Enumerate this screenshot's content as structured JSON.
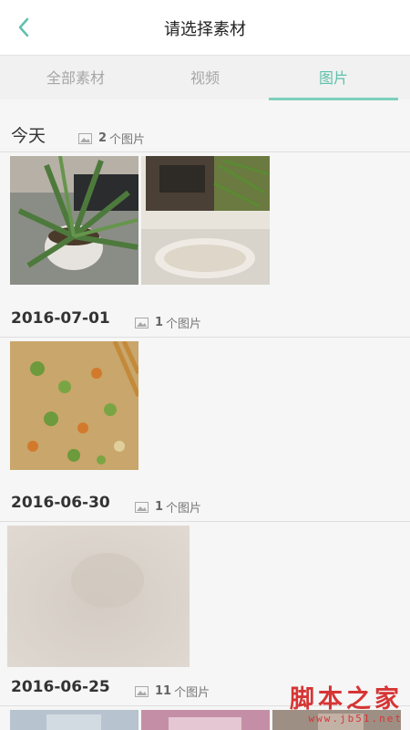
{
  "header": {
    "title": "请选择素材",
    "back_icon": "chevron-left-icon",
    "accent": "#5fc1ad"
  },
  "tabs": [
    {
      "label": "全部素材",
      "active": false
    },
    {
      "label": "视频",
      "active": false
    },
    {
      "label": "图片",
      "active": true
    }
  ],
  "groups": [
    {
      "date": "今天",
      "count_num": "2",
      "count_text": "个图片"
    },
    {
      "date": "2016-07-01",
      "count_num": "1",
      "count_text": "个图片"
    },
    {
      "date": "2016-06-30",
      "count_num": "1",
      "count_text": "个图片"
    },
    {
      "date": "2016-06-25",
      "count_num": "11",
      "count_text": "个图片"
    }
  ],
  "watermark": {
    "main": "脚本之家",
    "sub": "www.jb51.net"
  }
}
